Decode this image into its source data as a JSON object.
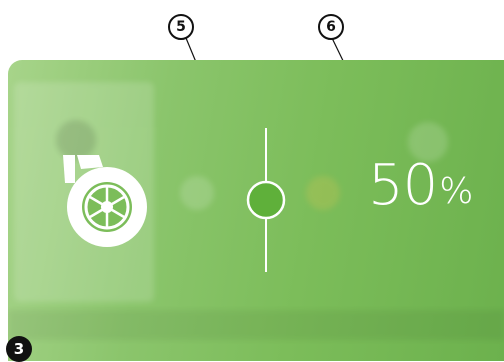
{
  "callouts": {
    "slider_marker": "5",
    "percent_marker": "6",
    "corner_badge": "3"
  },
  "display": {
    "value": "50",
    "unit": "%"
  },
  "slider": {
    "level": 0.5
  },
  "icon": "turbo-fan-icon",
  "colors": {
    "panel_light": "#a7d48a",
    "panel_dark": "#6cb14d",
    "knob": "#5fb03a",
    "white": "#ffffff"
  }
}
